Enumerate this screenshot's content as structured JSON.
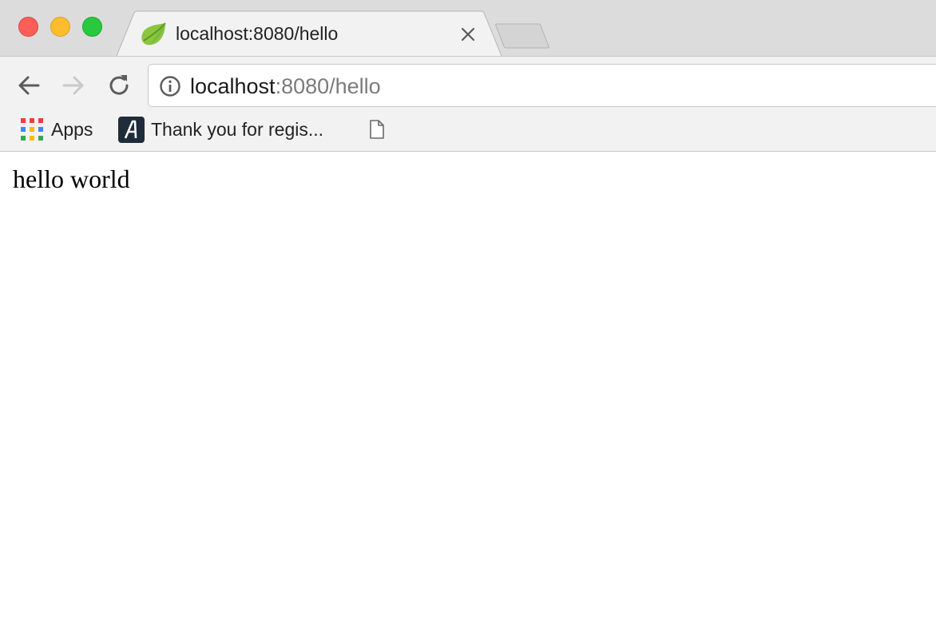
{
  "window": {
    "controls": [
      {
        "name": "close",
        "color": "#fc5f57"
      },
      {
        "name": "minimize",
        "color": "#fdbc2e"
      },
      {
        "name": "zoom",
        "color": "#28c840"
      }
    ]
  },
  "tab": {
    "title": "localhost:8080/hello",
    "favicon": "spring-leaf-icon",
    "close_icon": "close-icon"
  },
  "toolbar": {
    "back_icon": "back-arrow-icon",
    "forward_icon": "forward-arrow-icon",
    "reload_icon": "reload-icon",
    "address": {
      "info_icon": "info-icon",
      "host": "localhost",
      "rest": ":8080/hello"
    }
  },
  "bookmarks": {
    "items": [
      {
        "label": "Apps",
        "icon": "apps-grid-icon"
      },
      {
        "label": "Thank you for regis...",
        "icon": "a-logo-icon"
      },
      {
        "label": "",
        "icon": "page-icon"
      }
    ]
  },
  "page": {
    "text": "hello world"
  },
  "colors": {
    "tabstrip": "#dcdcdc",
    "toolbar": "#f2f2f2",
    "url_secondary": "#7b7b7b",
    "spring_green": "#6db33f"
  }
}
